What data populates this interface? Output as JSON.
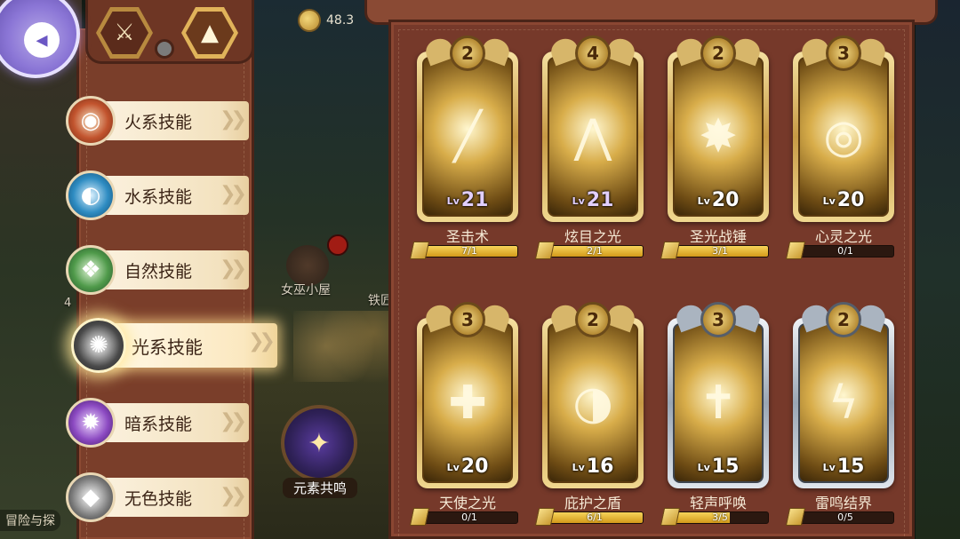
{
  "header": {
    "coin_value": "48.3"
  },
  "background": {
    "hut_label": "女巫小屋",
    "side_label": "铁匠",
    "left_number": "4",
    "bottom_left_label": "冒险与探"
  },
  "categories": [
    {
      "label": "火系技能",
      "icon": "fire-icon",
      "glyph": "◉",
      "active": false
    },
    {
      "label": "水系技能",
      "icon": "water-icon",
      "glyph": "◐",
      "active": false
    },
    {
      "label": "自然技能",
      "icon": "leaf-icon",
      "glyph": "❖",
      "active": false
    },
    {
      "label": "光系技能",
      "icon": "sun-icon",
      "glyph": "✺",
      "active": true
    },
    {
      "label": "暗系技能",
      "icon": "vortex-icon",
      "glyph": "✹",
      "active": false
    },
    {
      "label": "无色技能",
      "icon": "diamond-icon",
      "glyph": "◆",
      "active": false
    }
  ],
  "resonance": {
    "label": "元素共鸣",
    "icon": "element-resonance-icon"
  },
  "skills": [
    {
      "name": "圣击术",
      "stars": "2",
      "level": "21",
      "lv_prefix": "Lv",
      "progress": "7/1",
      "fill": 1.0,
      "tier": "gold",
      "purple": true,
      "glyph": "╱"
    },
    {
      "name": "炫目之光",
      "stars": "4",
      "level": "21",
      "lv_prefix": "Lv",
      "progress": "2/1",
      "fill": 1.0,
      "tier": "gold",
      "purple": true,
      "glyph": "⋀"
    },
    {
      "name": "圣光战锤",
      "stars": "2",
      "level": "20",
      "lv_prefix": "Lv",
      "progress": "3/1",
      "fill": 1.0,
      "tier": "gold",
      "purple": false,
      "glyph": "✸"
    },
    {
      "name": "心灵之光",
      "stars": "3",
      "level": "20",
      "lv_prefix": "Lv",
      "progress": "0/1",
      "fill": 0.0,
      "tier": "gold",
      "purple": false,
      "glyph": "◎"
    },
    {
      "name": "天使之光",
      "stars": "3",
      "level": "20",
      "lv_prefix": "Lv",
      "progress": "0/1",
      "fill": 0.0,
      "tier": "gold",
      "purple": false,
      "glyph": "✚"
    },
    {
      "name": "庇护之盾",
      "stars": "2",
      "level": "16",
      "lv_prefix": "Lv",
      "progress": "6/1",
      "fill": 1.0,
      "tier": "gold",
      "purple": false,
      "glyph": "◑"
    },
    {
      "name": "轻声呼唤",
      "stars": "3",
      "level": "15",
      "lv_prefix": "Lv",
      "progress": "3/5",
      "fill": 0.6,
      "tier": "silver",
      "purple": false,
      "glyph": "✝"
    },
    {
      "name": "雷鸣结界",
      "stars": "2",
      "level": "15",
      "lv_prefix": "Lv",
      "progress": "0/5",
      "fill": 0.0,
      "tier": "silver",
      "purple": false,
      "glyph": "ϟ"
    }
  ]
}
